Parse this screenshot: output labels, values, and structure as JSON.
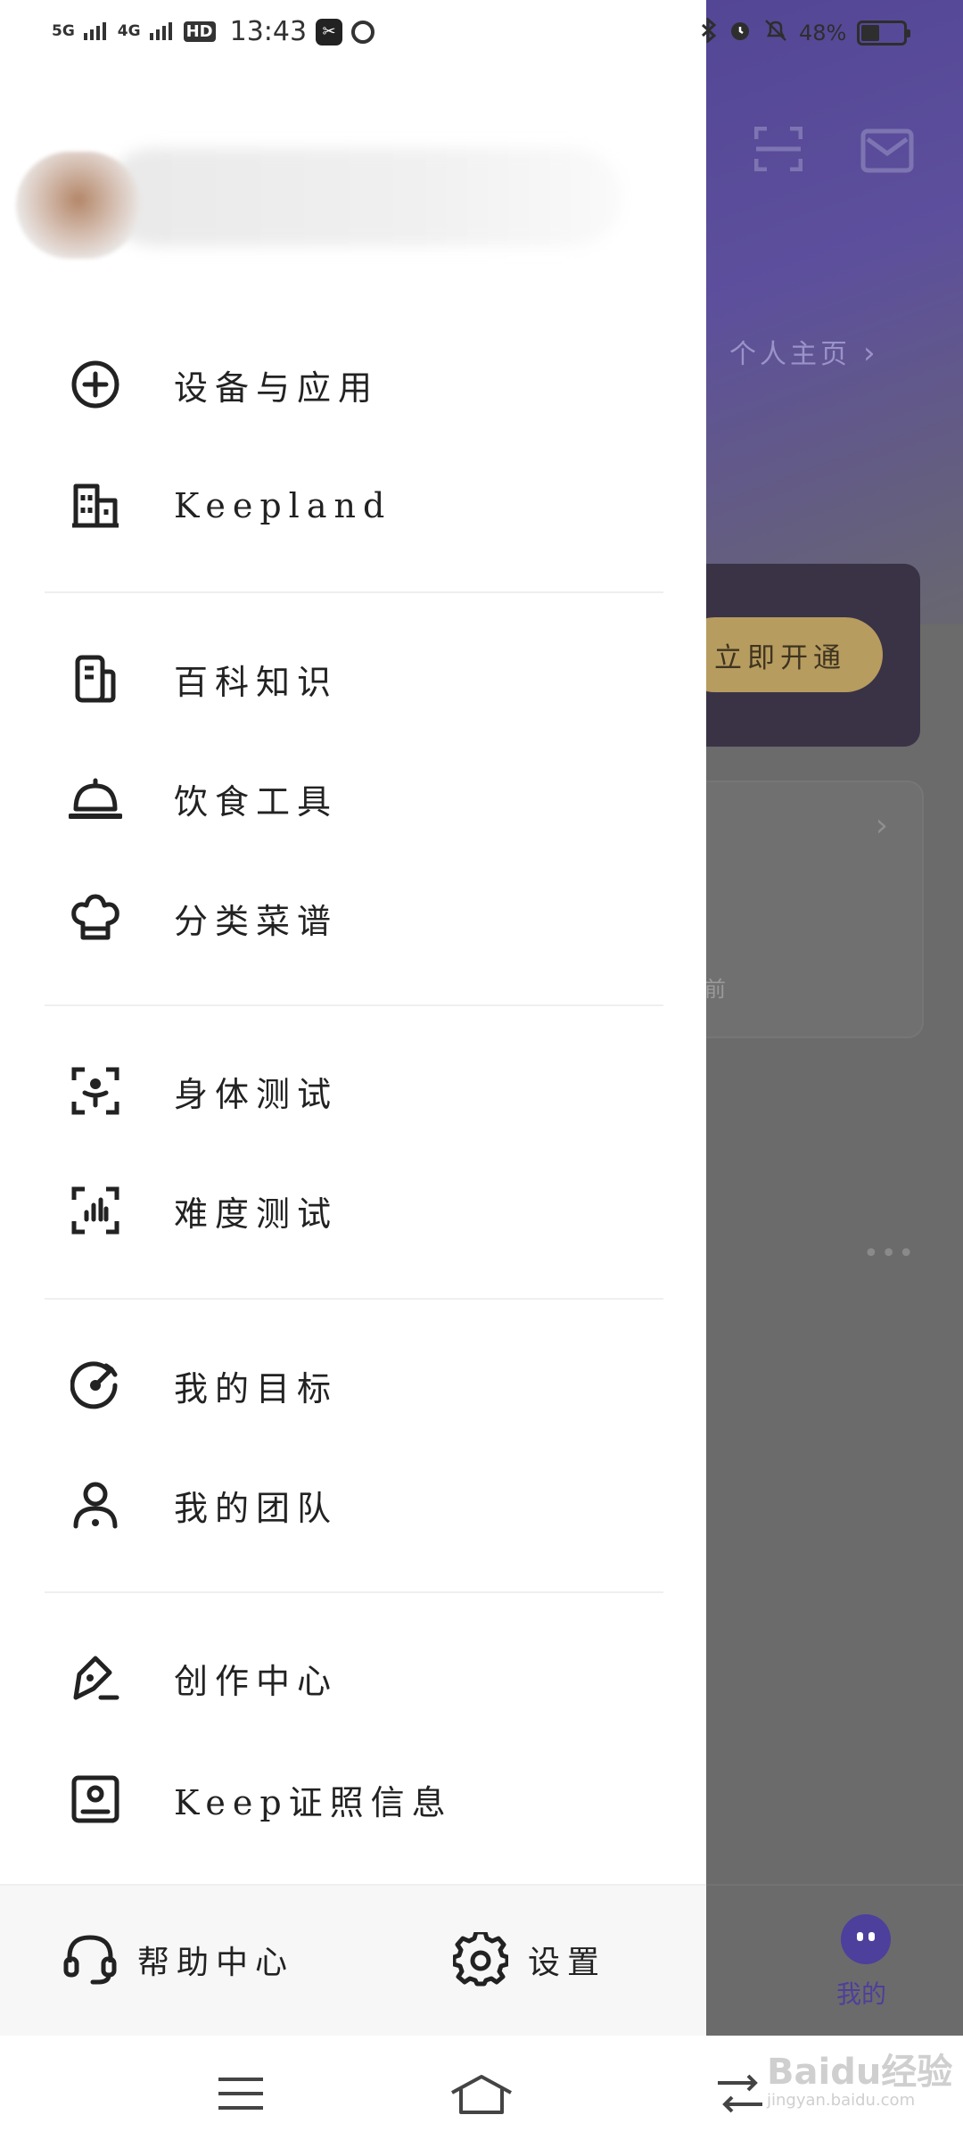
{
  "status_bar": {
    "signal_1": "5G",
    "signal_2": "4G",
    "hd": "HD",
    "time": "13:43",
    "battery": "48%"
  },
  "background_app": {
    "profile_link": "个人主页",
    "vip_button": "立即开通",
    "card_text": "前",
    "more": "•••",
    "tab_mine": "我的"
  },
  "drawer": {
    "menu": [
      {
        "label": "设备与应用",
        "icon": "plus-circle-icon"
      },
      {
        "label": "Keepland",
        "icon": "building-icon"
      },
      {
        "label": "百科知识",
        "icon": "document-icon"
      },
      {
        "label": "饮食工具",
        "icon": "service-bell-icon"
      },
      {
        "label": "分类菜谱",
        "icon": "chef-hat-icon"
      },
      {
        "label": "身体测试",
        "icon": "body-scan-icon"
      },
      {
        "label": "难度测试",
        "icon": "difficulty-scan-icon"
      },
      {
        "label": "我的目标",
        "icon": "target-icon"
      },
      {
        "label": "我的团队",
        "icon": "team-icon"
      },
      {
        "label": "创作中心",
        "icon": "pen-icon"
      },
      {
        "label": "Keep证照信息",
        "icon": "id-card-icon"
      }
    ],
    "footer": {
      "help_label": "帮助中心",
      "settings_label": "设置"
    }
  },
  "watermark": {
    "text": "Baidu经验",
    "sub": "jingyan.baidu.com"
  },
  "colors": {
    "accent": "#4d3f9c",
    "gold": "#b79c5f",
    "drawer_bg": "#ffffff"
  }
}
